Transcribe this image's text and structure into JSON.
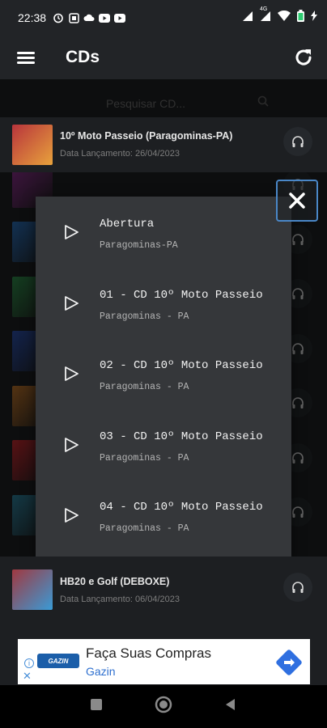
{
  "status_bar": {
    "time": "22:38",
    "network": "4G"
  },
  "app_bar": {
    "title": "CDs"
  },
  "search": {
    "placeholder": "Pesquisar CD..."
  },
  "list": {
    "items": [
      {
        "title": "10º Moto Passeio (Paragominas-PA)",
        "subtitle": "Data Lançamento: 26/04/2023",
        "thumb_color": "#b8343c"
      },
      {
        "title": "",
        "subtitle": "",
        "thumb_color": "#8a2e8c"
      },
      {
        "title": "",
        "subtitle": "",
        "thumb_color": "#2a6db5"
      },
      {
        "title": "",
        "subtitle": "",
        "thumb_color": "#2f8a4a"
      },
      {
        "title": "",
        "subtitle": "",
        "thumb_color": "#2b4fa8"
      },
      {
        "title": "",
        "subtitle": "",
        "thumb_color": "#b8712a"
      },
      {
        "title": "",
        "subtitle": "",
        "thumb_color": "#c0282e"
      },
      {
        "title": "",
        "subtitle": "",
        "thumb_color": "#2d7f9a"
      },
      {
        "title": "HB20 e Golf (DEBOXE)",
        "subtitle": "Data Lançamento: 06/04/2023",
        "thumb_color": "#a03840"
      }
    ]
  },
  "dialog": {
    "tracks": [
      {
        "title": "Abertura",
        "subtitle": "Paragominas-PA"
      },
      {
        "title": "01 - CD 10º Moto Passeio",
        "subtitle": "Paragominas - PA"
      },
      {
        "title": "02 - CD 10º Moto Passeio",
        "subtitle": "Paragominas - PA"
      },
      {
        "title": "03 - CD 10º Moto Passeio",
        "subtitle": "Paragominas - PA"
      },
      {
        "title": "04 - CD 10º Moto Passeio",
        "subtitle": "Paragominas - PA"
      }
    ]
  },
  "ad": {
    "headline": "Faça Suas Compras",
    "brand": "Gazin",
    "logo_text": "GAZIN"
  },
  "colors": {
    "accent": "#4a87c7",
    "background": "#1d1f22",
    "dialog": "#35373a"
  }
}
